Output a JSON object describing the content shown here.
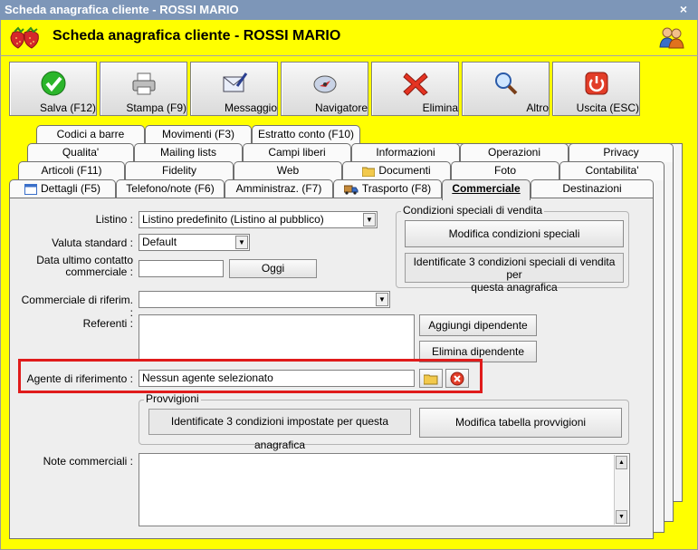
{
  "window": {
    "title": "Scheda anagrafica cliente - ROSSI MARIO",
    "close_label": "×"
  },
  "header": {
    "title": "Scheda anagrafica cliente - ROSSI MARIO"
  },
  "toolbar": [
    {
      "label": "Salva (F12)",
      "icon": "check-icon"
    },
    {
      "label": "Stampa (F9)",
      "icon": "printer-icon"
    },
    {
      "label": "Messaggio",
      "icon": "envelope-icon"
    },
    {
      "label": "Navigatore",
      "icon": "compass-icon"
    },
    {
      "label": "Elimina",
      "icon": "delete-x-icon"
    },
    {
      "label": "Altro",
      "icon": "magnifier-icon"
    },
    {
      "label": "Uscita (ESC)",
      "icon": "power-icon"
    }
  ],
  "tabs": {
    "row1": [
      "Codici a barre",
      "Movimenti (F3)",
      "Estratto conto (F10)"
    ],
    "row2": [
      "Qualita'",
      "Mailing lists",
      "Campi liberi",
      "Informazioni",
      "Operazioni",
      "Privacy"
    ],
    "row3": [
      "Articoli (F11)",
      "Fidelity",
      "Web",
      "Documenti",
      "Foto",
      "Contabilita'"
    ],
    "row4": [
      "Dettagli (F5)",
      "Telefono/note (F6)",
      "Amministraz. (F7)",
      "Trasporto (F8)",
      "Commerciale",
      "Destinazioni"
    ],
    "active": "Commerciale"
  },
  "form": {
    "listino_label": "Listino :",
    "listino_value": "Listino predefinito (Listino al pubblico)",
    "valuta_label": "Valuta standard :",
    "valuta_value": "Default",
    "data_contatto_label_1": "Data ultimo contatto",
    "data_contatto_label_2": "commerciale :",
    "data_contatto_value": "",
    "oggi_button": "Oggi",
    "commerciale_label": "Commerciale di riferim. :",
    "commerciale_value": "",
    "referenti_label": "Referenti :",
    "aggiungi_dipendente": "Aggiungi dipendente",
    "elimina_dipendente": "Elimina dipendente",
    "agente_label": "Agente di riferimento :",
    "agente_value": "Nessun agente selezionato",
    "note_label": "Note commerciali :",
    "note_value": ""
  },
  "condizioni": {
    "title": "Condizioni speciali di vendita",
    "button": "Modifica condizioni speciali",
    "info_line1": "Identificate 3 condizioni speciali di vendita per",
    "info_line2": "questa anagrafica"
  },
  "provvigioni": {
    "title": "Provvigioni",
    "info": "Identificate 3 condizioni impostate per questa anagrafica",
    "button": "Modifica tabella provvigioni"
  },
  "colors": {
    "background": "#ffff00",
    "titlebar": "#7d96b8",
    "highlight": "#e01b1b"
  }
}
